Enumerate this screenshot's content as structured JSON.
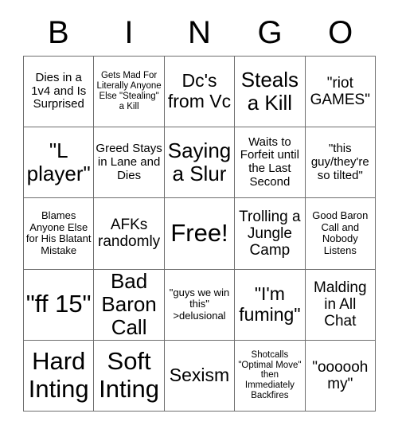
{
  "header": {
    "letters": [
      "B",
      "I",
      "N",
      "G",
      "O"
    ]
  },
  "grid": {
    "columns": 5,
    "rows": 5,
    "cells": [
      {
        "text": "Dies in a 1v4 and Is Surprised",
        "size": "fs-sm"
      },
      {
        "text": "Gets Mad For Literally Anyone Else \"Stealing\" a Kill",
        "size": "fs-xxs"
      },
      {
        "text": "Dc's from Vc",
        "size": "fs-lg"
      },
      {
        "text": "Steals a Kill",
        "size": "fs-xl"
      },
      {
        "text": "\"riot GAMES\"",
        "size": "fs-md"
      },
      {
        "text": "\"L player\"",
        "size": "fs-xl"
      },
      {
        "text": "Greed Stays in Lane and Dies",
        "size": "fs-sm"
      },
      {
        "text": "Saying a Slur",
        "size": "fs-xl"
      },
      {
        "text": "Waits to Forfeit until the Last Second",
        "size": "fs-sm"
      },
      {
        "text": "\"this guy/they're so tilted\"",
        "size": "fs-sm"
      },
      {
        "text": "Blames Anyone Else for His Blatant Mistake",
        "size": "fs-xs"
      },
      {
        "text": "AFKs randomly",
        "size": "fs-md"
      },
      {
        "text": "Free!",
        "size": "fs-xxl"
      },
      {
        "text": "Trolling a Jungle Camp",
        "size": "fs-md"
      },
      {
        "text": "Good Baron Call and Nobody Listens",
        "size": "fs-xs"
      },
      {
        "text": "\"ff 15\"",
        "size": "fs-xxl"
      },
      {
        "text": "Bad Baron Call",
        "size": "fs-xl"
      },
      {
        "text": "\"guys we win this\" >delusional",
        "size": "fs-xs"
      },
      {
        "text": "\"I'm fuming\"",
        "size": "fs-lg"
      },
      {
        "text": "Malding in All Chat",
        "size": "fs-md"
      },
      {
        "text": "Hard Inting",
        "size": "fs-xxl"
      },
      {
        "text": "Soft Inting",
        "size": "fs-xxl"
      },
      {
        "text": "Sexism",
        "size": "fs-lg"
      },
      {
        "text": "Shotcalls \"Optimal Move\" then Immediately Backfires",
        "size": "fs-xxs"
      },
      {
        "text": "\"oooooh my\"",
        "size": "fs-md"
      }
    ]
  }
}
